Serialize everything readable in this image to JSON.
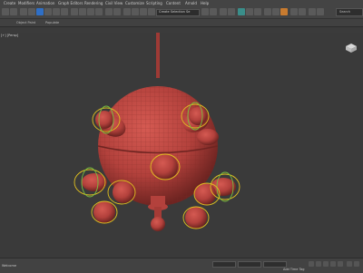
{
  "menu": [
    {
      "label": "Create"
    },
    {
      "label": "Modifiers"
    },
    {
      "label": "Animation"
    },
    {
      "label": "Graph Editors"
    },
    {
      "label": "Rendering"
    },
    {
      "label": "Civil View"
    },
    {
      "label": "Customize"
    },
    {
      "label": "Scripting"
    },
    {
      "label": "Content"
    },
    {
      "label": "Arnold"
    },
    {
      "label": "Help"
    }
  ],
  "toolbar": {
    "selection_set": "Create Selection Se",
    "search_label": "Search"
  },
  "ribbon": {
    "tab1": "Object Paint",
    "tab2": "Populate"
  },
  "viewport": {
    "label": "[+] [Persp]"
  },
  "status": {
    "left_text": "Welcome",
    "add_time_tag": "Add Time Tag"
  },
  "colors": {
    "model": "#b3413c",
    "handles": "#e0c020",
    "accent": "#2f6fc6"
  }
}
